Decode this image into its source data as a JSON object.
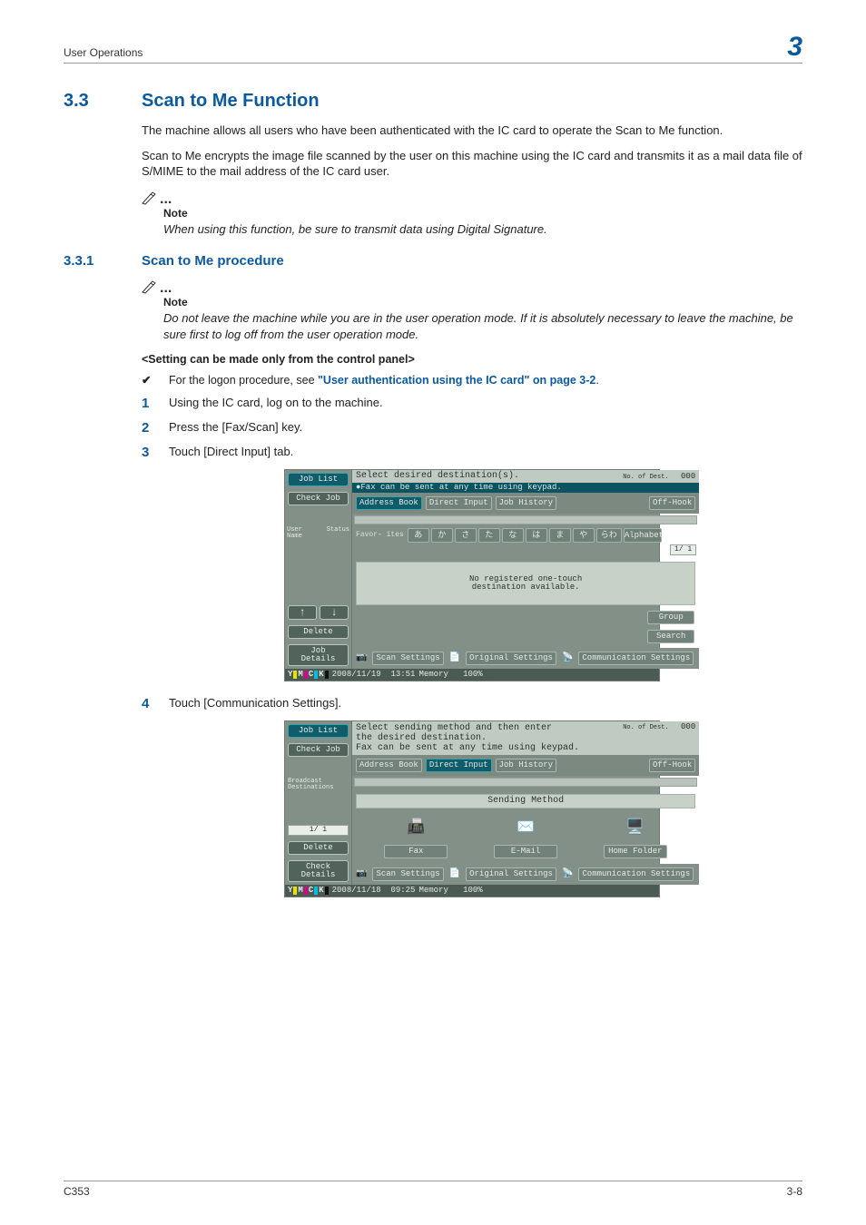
{
  "page": {
    "running_title": "User Operations",
    "chapter_number": "3",
    "footer_left": "C353",
    "footer_right": "3-8"
  },
  "section": {
    "number": "3.3",
    "title": "Scan to Me Function",
    "para1": "The machine allows all users who have been authenticated with the IC card to operate the Scan to Me function.",
    "para2": "Scan to Me encrypts the image file scanned by the user on this machine using the IC card and transmits it as a mail data file of S/MIME to the mail address of the IC card user.",
    "note_label": "Note",
    "note_text": "When using this function, be sure to transmit data using Digital Signature."
  },
  "subsection": {
    "number": "3.3.1",
    "title": "Scan to Me procedure",
    "note_label": "Note",
    "note_text": "Do not leave the machine while you are in the user operation mode. If it is absolutely necessary to leave the machine, be sure first to log off from the user operation mode.",
    "panel_hint": "<Setting can be made only from the control panel>",
    "check_prefix": "For the logon procedure, see ",
    "check_link": "\"User authentication using the IC card\" on page 3-2",
    "check_suffix": ".",
    "steps": [
      "Using the IC card, log on to the machine.",
      "Press the [Fax/Scan] key.",
      "Touch [Direct Input] tab.",
      "Touch [Communication Settings]."
    ]
  },
  "screenshot1": {
    "header_text": "Select desired destination(s).",
    "dest_count_label": "No. of Dest.",
    "dest_count_value": "000",
    "yellow_tip": "●Fax can be sent at any time using keypad.",
    "tabs": {
      "address_book": "Address Book",
      "direct_input": "Direct Input",
      "job_history": "Job History"
    },
    "off_hook": "Off-Hook",
    "left": {
      "job_list": "Job List",
      "check_job": "Check Job",
      "user_name": "User Name",
      "status": "Status",
      "delete": "Delete",
      "job_details": "Job Details"
    },
    "favor_label": "Favor-\nites",
    "kana": [
      "あ",
      "か",
      "さ",
      "た",
      "な",
      "は",
      "ま",
      "や",
      "らわ"
    ],
    "alphabet": "Alphabet",
    "page_mark": "1/ 1",
    "body_msg1": "No registered one-touch",
    "body_msg2": "destination available.",
    "group": "Group",
    "search": "Search",
    "bottom": {
      "scan_settings": "Scan Settings",
      "original_settings": "Original Settings",
      "comm_settings": "Communication Settings"
    },
    "status_bar": {
      "date": "2008/11/19",
      "time": "13:51",
      "memory_label": "Memory",
      "memory_value": "100%"
    }
  },
  "screenshot2": {
    "header_line1": "Select sending method and then enter",
    "header_line2": "the desired destination.",
    "header_line3": "Fax can be sent at any time using keypad.",
    "dest_count_label": "No. of Dest.",
    "dest_count_value": "000",
    "tabs": {
      "address_book": "Address Book",
      "direct_input": "Direct Input",
      "job_history": "Job History"
    },
    "off_hook": "Off-Hook",
    "left": {
      "job_list": "Job List",
      "check_job": "Check Job",
      "broadcast": "Broadcast Destinations",
      "page_mark": "1/ 1",
      "delete": "Delete",
      "check_details": "Check Details"
    },
    "sending_method": "Sending Method",
    "options": {
      "fax": "Fax",
      "email": "E-Mail",
      "home_folder": "Home Folder"
    },
    "bottom": {
      "scan_settings": "Scan Settings",
      "original_settings": "Original Settings",
      "comm_settings": "Communication Settings"
    },
    "status_bar": {
      "date": "2008/11/18",
      "time": "09:25",
      "memory_label": "Memory",
      "memory_value": "100%"
    }
  }
}
